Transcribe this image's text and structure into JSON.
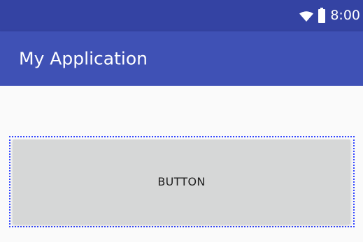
{
  "status_bar": {
    "time": "8:00",
    "icons": [
      "wifi-icon",
      "battery-icon"
    ]
  },
  "app_bar": {
    "title": "My Application"
  },
  "main": {
    "button_label": "BUTTON"
  },
  "colors": {
    "status_bar": "#3443a3",
    "app_bar": "#3f51b5",
    "background": "#fafafa",
    "button": "#d6d7d7",
    "focus_ring": "#3346ff",
    "text_on_primary": "#ffffff",
    "button_text": "#1f1f1f"
  }
}
